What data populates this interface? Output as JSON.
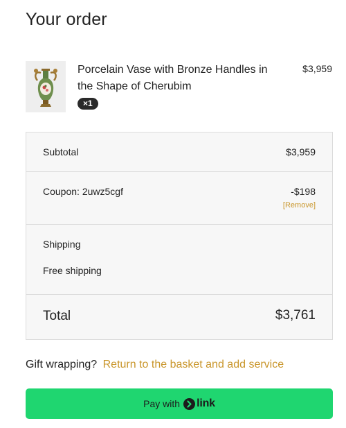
{
  "page": {
    "title": "Your order"
  },
  "order_item": {
    "name": "Porcelain Vase with Bronze Handles in the Shape of Cherubim",
    "quantity": "×1",
    "price": "$3,959",
    "thumbnail": "porcelain-vase-image"
  },
  "summary": {
    "subtotal_label": "Subtotal",
    "subtotal_value": "$3,959",
    "coupon_label": "Coupon: 2uwz5cgf",
    "coupon_value": "-$198",
    "coupon_remove": "[Remove]",
    "shipping_label": "Shipping",
    "shipping_value": "Free shipping",
    "total_label": "Total",
    "total_value": "$3,761"
  },
  "gift": {
    "question": "Gift wrapping?",
    "link_text": "Return to the basket and add service"
  },
  "pay_button": {
    "label": "Pay with",
    "brand_icon": "chevron-circle-icon",
    "brand_text": "link"
  },
  "colors": {
    "accent_link": "#c9962b",
    "pay_button_bg": "#1fd670",
    "summary_bg": "#f7f7f7",
    "badge_bg": "#2a2a2a"
  }
}
